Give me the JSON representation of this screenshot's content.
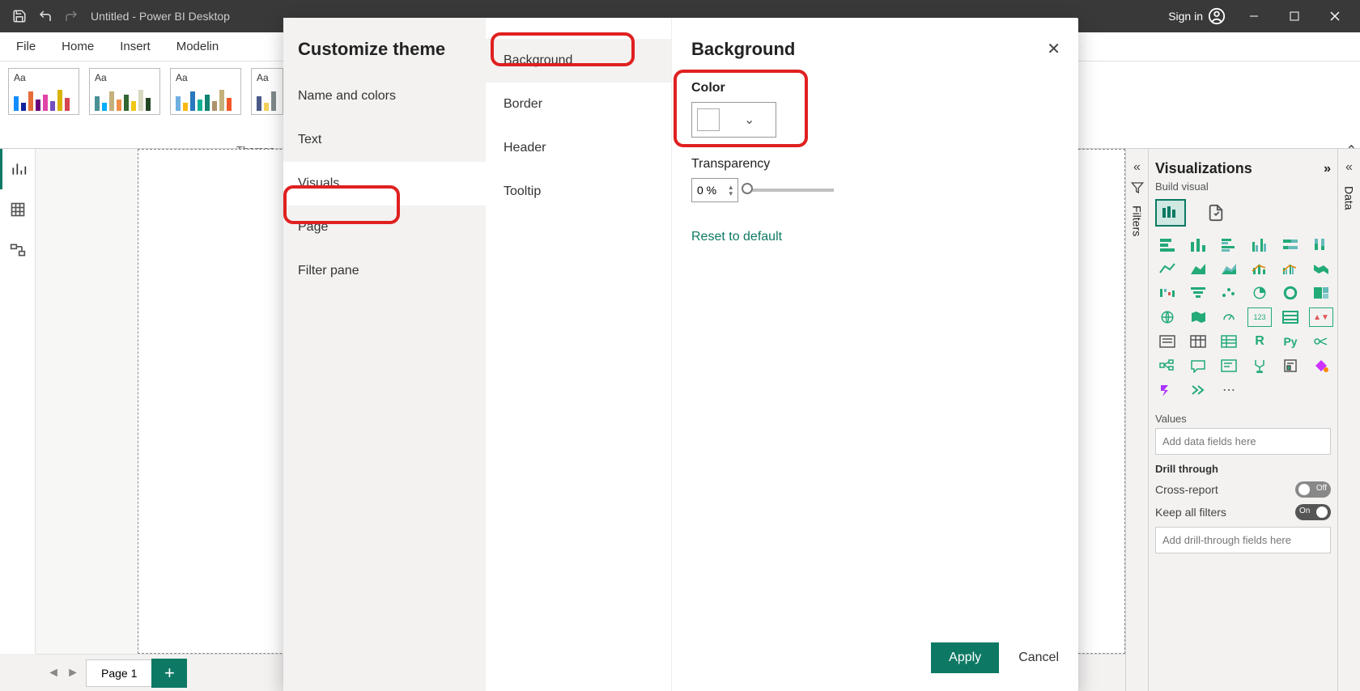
{
  "titlebar": {
    "title": "Untitled - Power BI Desktop",
    "signin": "Sign in"
  },
  "ribbon": {
    "tabs": [
      "File",
      "Home",
      "Insert",
      "Modelin"
    ],
    "themes_label": "Themes",
    "theme_aa": "Aa"
  },
  "pages": {
    "page1": "Page 1",
    "add": "+"
  },
  "filters_pane": {
    "label": "Filters"
  },
  "data_pane": {
    "label": "Data"
  },
  "viz_pane": {
    "title": "Visualizations",
    "subtitle": "Build visual",
    "values_label": "Values",
    "values_placeholder": "Add data fields here",
    "drill_label": "Drill through",
    "cross_report": "Cross-report",
    "cross_report_state": "Off",
    "keep_filters": "Keep all filters",
    "keep_filters_state": "On",
    "drill_placeholder": "Add drill-through fields here"
  },
  "dialog": {
    "title": "Customize theme",
    "col1": {
      "name_colors": "Name and colors",
      "text": "Text",
      "visuals": "Visuals",
      "page": "Page",
      "filter_pane": "Filter pane"
    },
    "col2": {
      "background": "Background",
      "border": "Border",
      "header": "Header",
      "tooltip": "Tooltip"
    },
    "col3": {
      "heading": "Background",
      "color_label": "Color",
      "transparency_label": "Transparency",
      "transparency_value": "0 %",
      "reset": "Reset to default"
    },
    "footer": {
      "apply": "Apply",
      "cancel": "Cancel"
    }
  }
}
